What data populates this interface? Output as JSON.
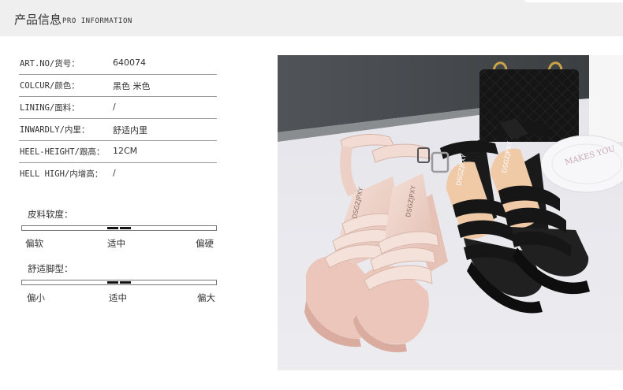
{
  "header": {
    "title_cn": "产品信息",
    "title_en": "PRO INFORMATION"
  },
  "specs": [
    {
      "label": "ART.NO/货号：",
      "value": "640074"
    },
    {
      "label": "COLCUR/颜色：",
      "value": "黑色 米色"
    },
    {
      "label": "LINING/面料：",
      "value": "/"
    },
    {
      "label": "INWARDLY/内里：",
      "value": "舒适内里"
    },
    {
      "label": "HEEL-HEIGHT/跟高：",
      "value": "12CM"
    },
    {
      "label": "HELL HIGH/内增高：",
      "value": "/"
    }
  ],
  "softness": {
    "title": "皮料软度：",
    "labels": [
      "偏软",
      "适中",
      "偏硬"
    ],
    "level": 0.5
  },
  "fit": {
    "title": "舒适脚型：",
    "labels": [
      "偏小",
      "适中",
      "偏大"
    ],
    "level": 0.5
  },
  "photo": {
    "insole_text_pink": "DSGZJPXY",
    "insole_text_black": "DSGZJPXY",
    "plate_text": "MAKES YOU"
  },
  "colors": {
    "header_bg": "#efefef",
    "pink_leather": "#efd5cb",
    "black_leather": "#141414"
  }
}
